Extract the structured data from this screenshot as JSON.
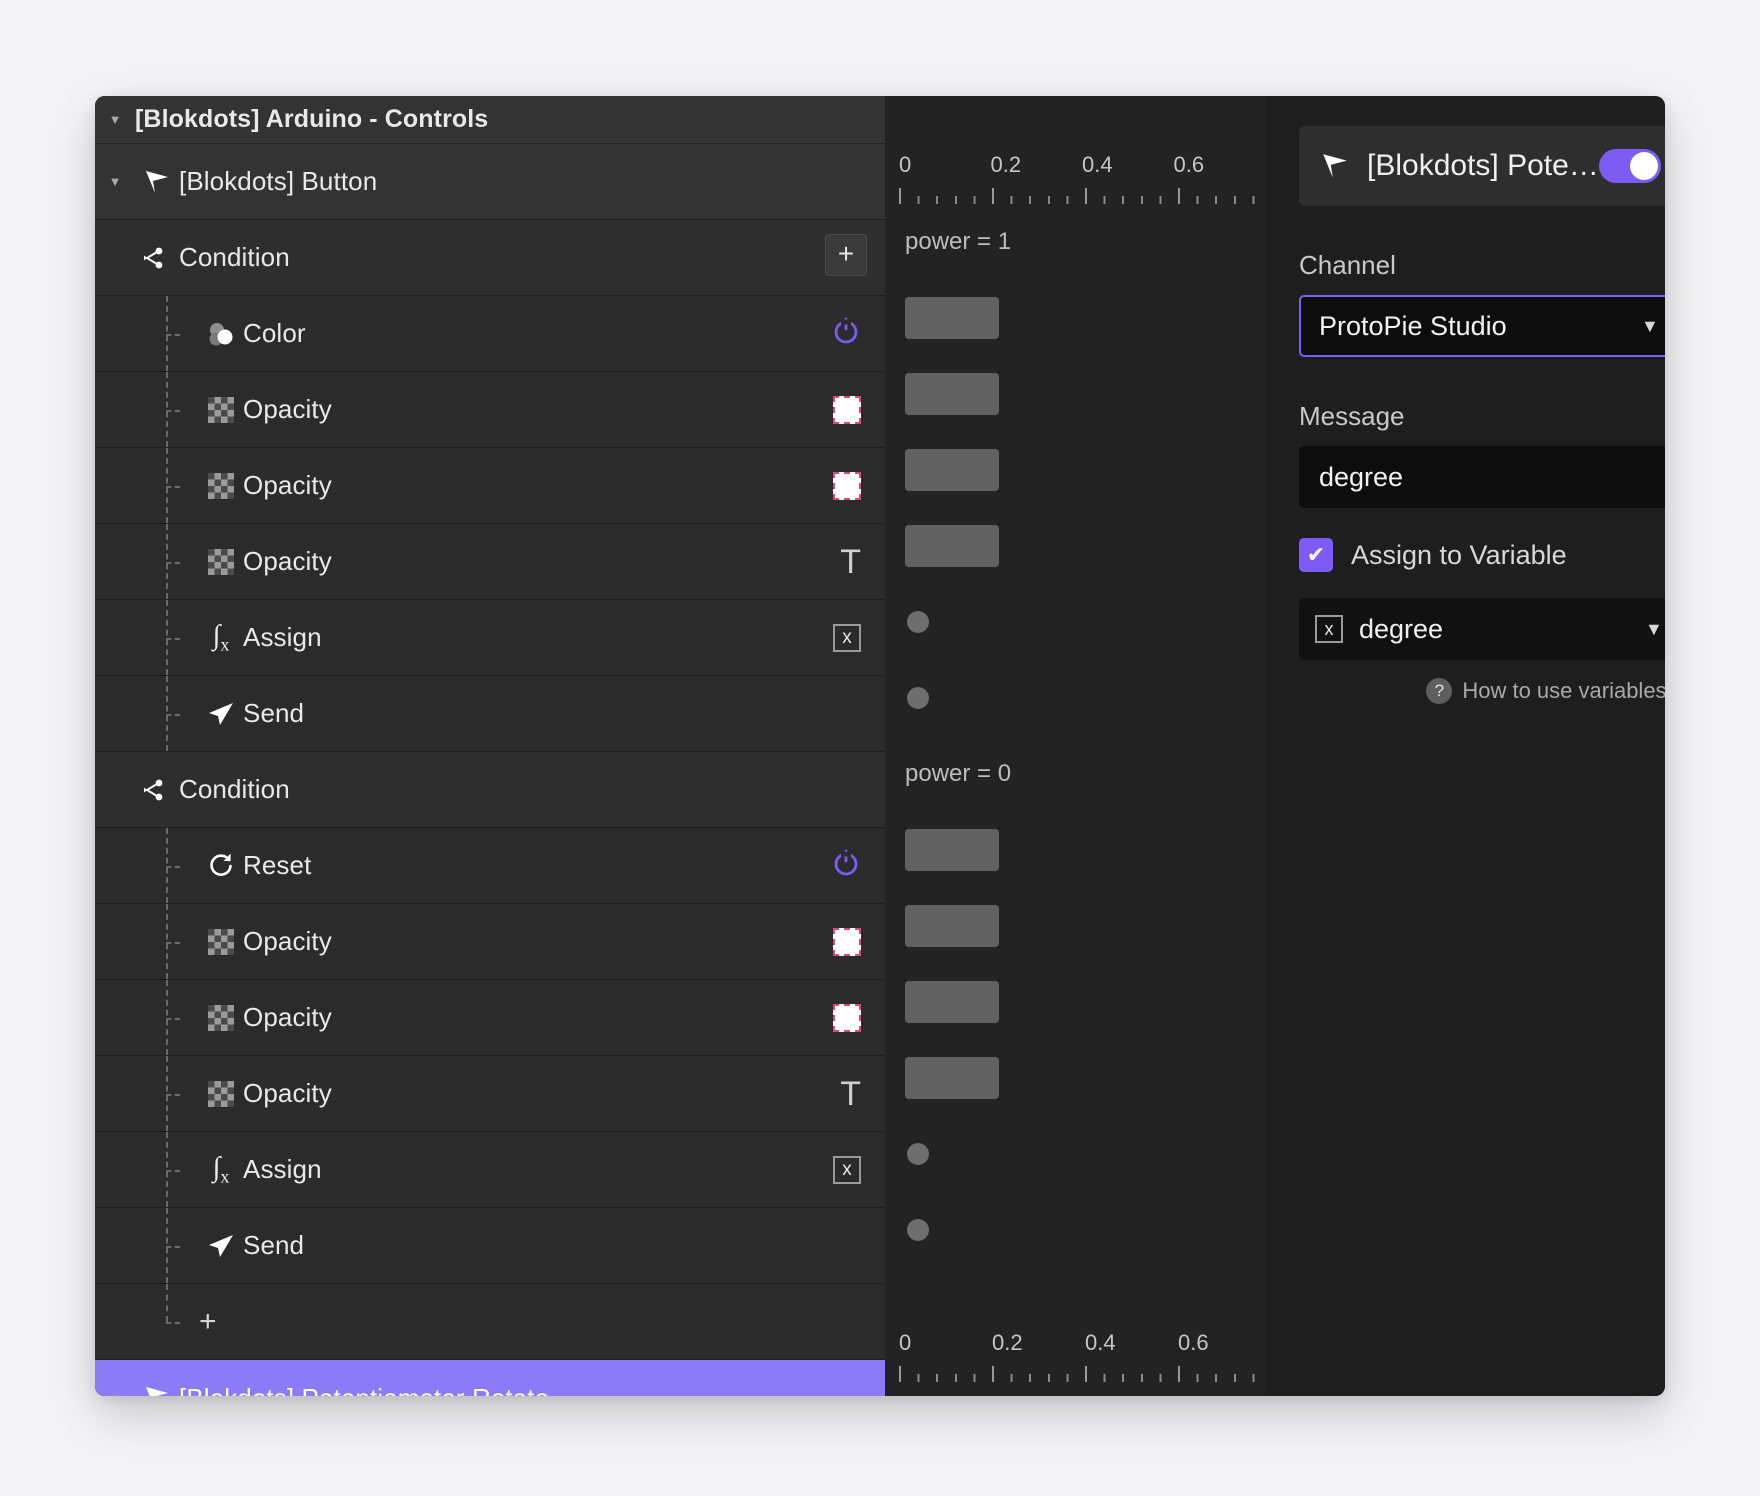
{
  "window": {
    "title": "[Blokdots] Arduino - Controls"
  },
  "tree": {
    "group_label": "[Blokdots] Button",
    "add_button_label": "+",
    "add_row_label": "+",
    "selected_label": "[Blokdots] Potentiometer Rotate",
    "rows": [
      {
        "label": "Condition",
        "icon": "condition-icon",
        "kind": "sub",
        "trailing": "none",
        "timeline": "text",
        "timeline_text": "power = 1"
      },
      {
        "label": "Color",
        "icon": "color-icon",
        "kind": "child",
        "trailing": "power",
        "timeline": "bar"
      },
      {
        "label": "Opacity",
        "icon": "opacity-icon",
        "kind": "child",
        "trailing": "square",
        "timeline": "bar"
      },
      {
        "label": "Opacity",
        "icon": "opacity-icon",
        "kind": "child",
        "trailing": "square",
        "timeline": "bar"
      },
      {
        "label": "Opacity",
        "icon": "opacity-icon",
        "kind": "child",
        "trailing": "text-t",
        "timeline": "bar"
      },
      {
        "label": "Assign",
        "icon": "assign-icon",
        "kind": "child",
        "trailing": "variable",
        "timeline": "dot"
      },
      {
        "label": "Send",
        "icon": "send-icon",
        "kind": "child",
        "trailing": "none",
        "timeline": "dot"
      },
      {
        "label": "Condition",
        "icon": "condition-icon",
        "kind": "sub",
        "trailing": "none",
        "timeline": "text",
        "timeline_text": "power = 0"
      },
      {
        "label": "Reset",
        "icon": "reset-icon",
        "kind": "child",
        "trailing": "power",
        "timeline": "bar"
      },
      {
        "label": "Opacity",
        "icon": "opacity-icon",
        "kind": "child",
        "trailing": "square",
        "timeline": "bar"
      },
      {
        "label": "Opacity",
        "icon": "opacity-icon",
        "kind": "child",
        "trailing": "square",
        "timeline": "bar"
      },
      {
        "label": "Opacity",
        "icon": "opacity-icon",
        "kind": "child",
        "trailing": "text-t",
        "timeline": "bar"
      },
      {
        "label": "Assign",
        "icon": "assign-icon",
        "kind": "child",
        "trailing": "variable",
        "timeline": "dot"
      },
      {
        "label": "Send",
        "icon": "send-icon",
        "kind": "child",
        "trailing": "none",
        "timeline": "dot"
      }
    ]
  },
  "timeline": {
    "ticks_top": [
      "0",
      "0.2",
      "0.4",
      "0.6"
    ],
    "ticks_bottom": [
      "0",
      "0.2",
      "0.4",
      "0.6"
    ]
  },
  "inspector": {
    "title": "[Blokdots] Pote…",
    "toggle_on": true,
    "channel_label": "Channel",
    "channel_value": "ProtoPie Studio",
    "message_label": "Message",
    "message_value": "degree",
    "assign_checkbox_label": "Assign to Variable",
    "assign_checked": true,
    "variable_value": "degree",
    "variable_icon_glyph": "x",
    "help_text": "How to use variables?",
    "help_icon_glyph": "?",
    "caret_glyph": "▼",
    "check_glyph": "✔"
  },
  "colors": {
    "accent": "#7c5cf5",
    "selected_row": "#8b7bf7",
    "panel_bg": "#2b2b2b",
    "inspector_bg": "#1e1e1e",
    "timeline_bg": "#232323",
    "target_outline": "#e0457b"
  }
}
